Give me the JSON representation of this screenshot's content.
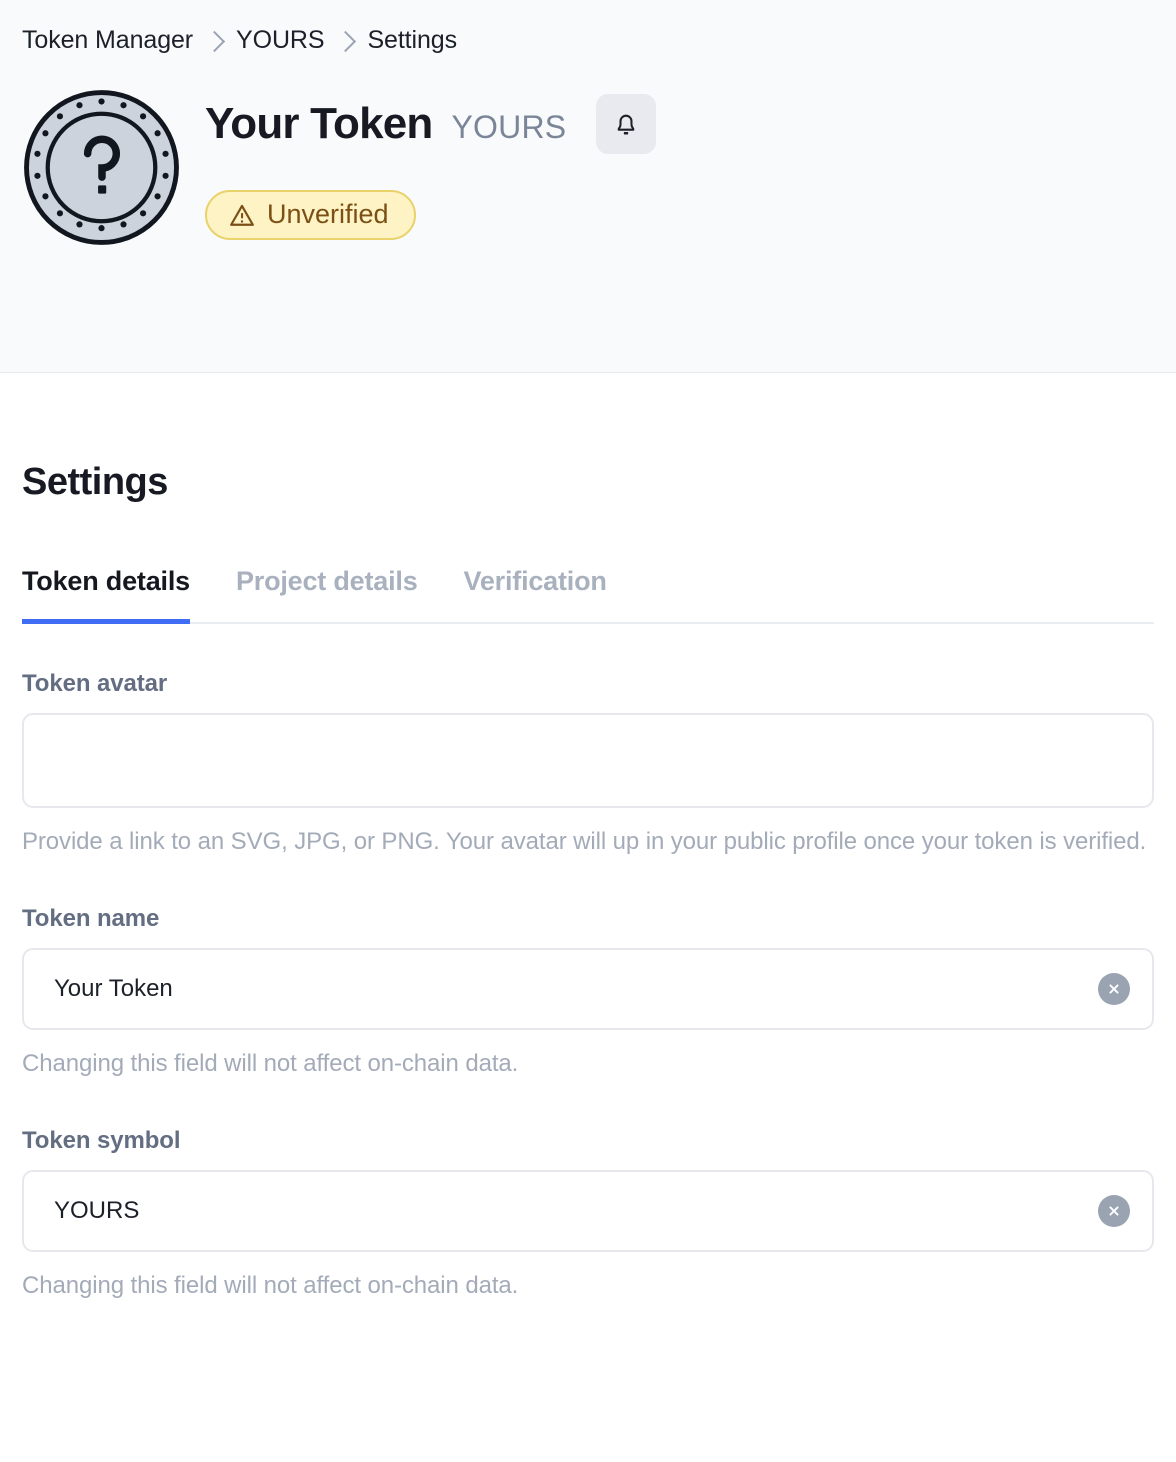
{
  "breadcrumb": {
    "items": [
      {
        "label": "Token Manager"
      },
      {
        "label": "YOURS"
      },
      {
        "label": "Settings"
      }
    ]
  },
  "header": {
    "avatar_icon": "unknown-token-coin-icon",
    "token_name": "Your Token",
    "token_symbol": "YOURS",
    "notifications_icon": "bell-icon",
    "badge": {
      "label": "Unverified",
      "icon": "warning-triangle-icon",
      "bg_color": "#fdf3c4",
      "border_color": "#e9d269",
      "text_color": "#7c4f16"
    }
  },
  "main": {
    "title": "Settings",
    "accent_color": "#3f6ef4",
    "tabs": [
      {
        "label": "Token details",
        "active": true
      },
      {
        "label": "Project details",
        "active": false
      },
      {
        "label": "Verification",
        "active": false
      }
    ],
    "fields": [
      {
        "label": "Token avatar",
        "value": "",
        "placeholder": "",
        "helper": "Provide a link to an SVG, JPG, or PNG. Your avatar will up in your public profile once your token is verified.",
        "has_clear": false
      },
      {
        "label": "Token name",
        "value": "Your Token",
        "placeholder": "",
        "helper": "Changing this field will not affect on-chain data.",
        "has_clear": true,
        "clear_icon": "clear-circle-icon"
      },
      {
        "label": "Token symbol",
        "value": "YOURS",
        "placeholder": "",
        "helper": "Changing this field will not affect on-chain data.",
        "has_clear": true,
        "clear_icon": "clear-circle-icon"
      }
    ]
  }
}
